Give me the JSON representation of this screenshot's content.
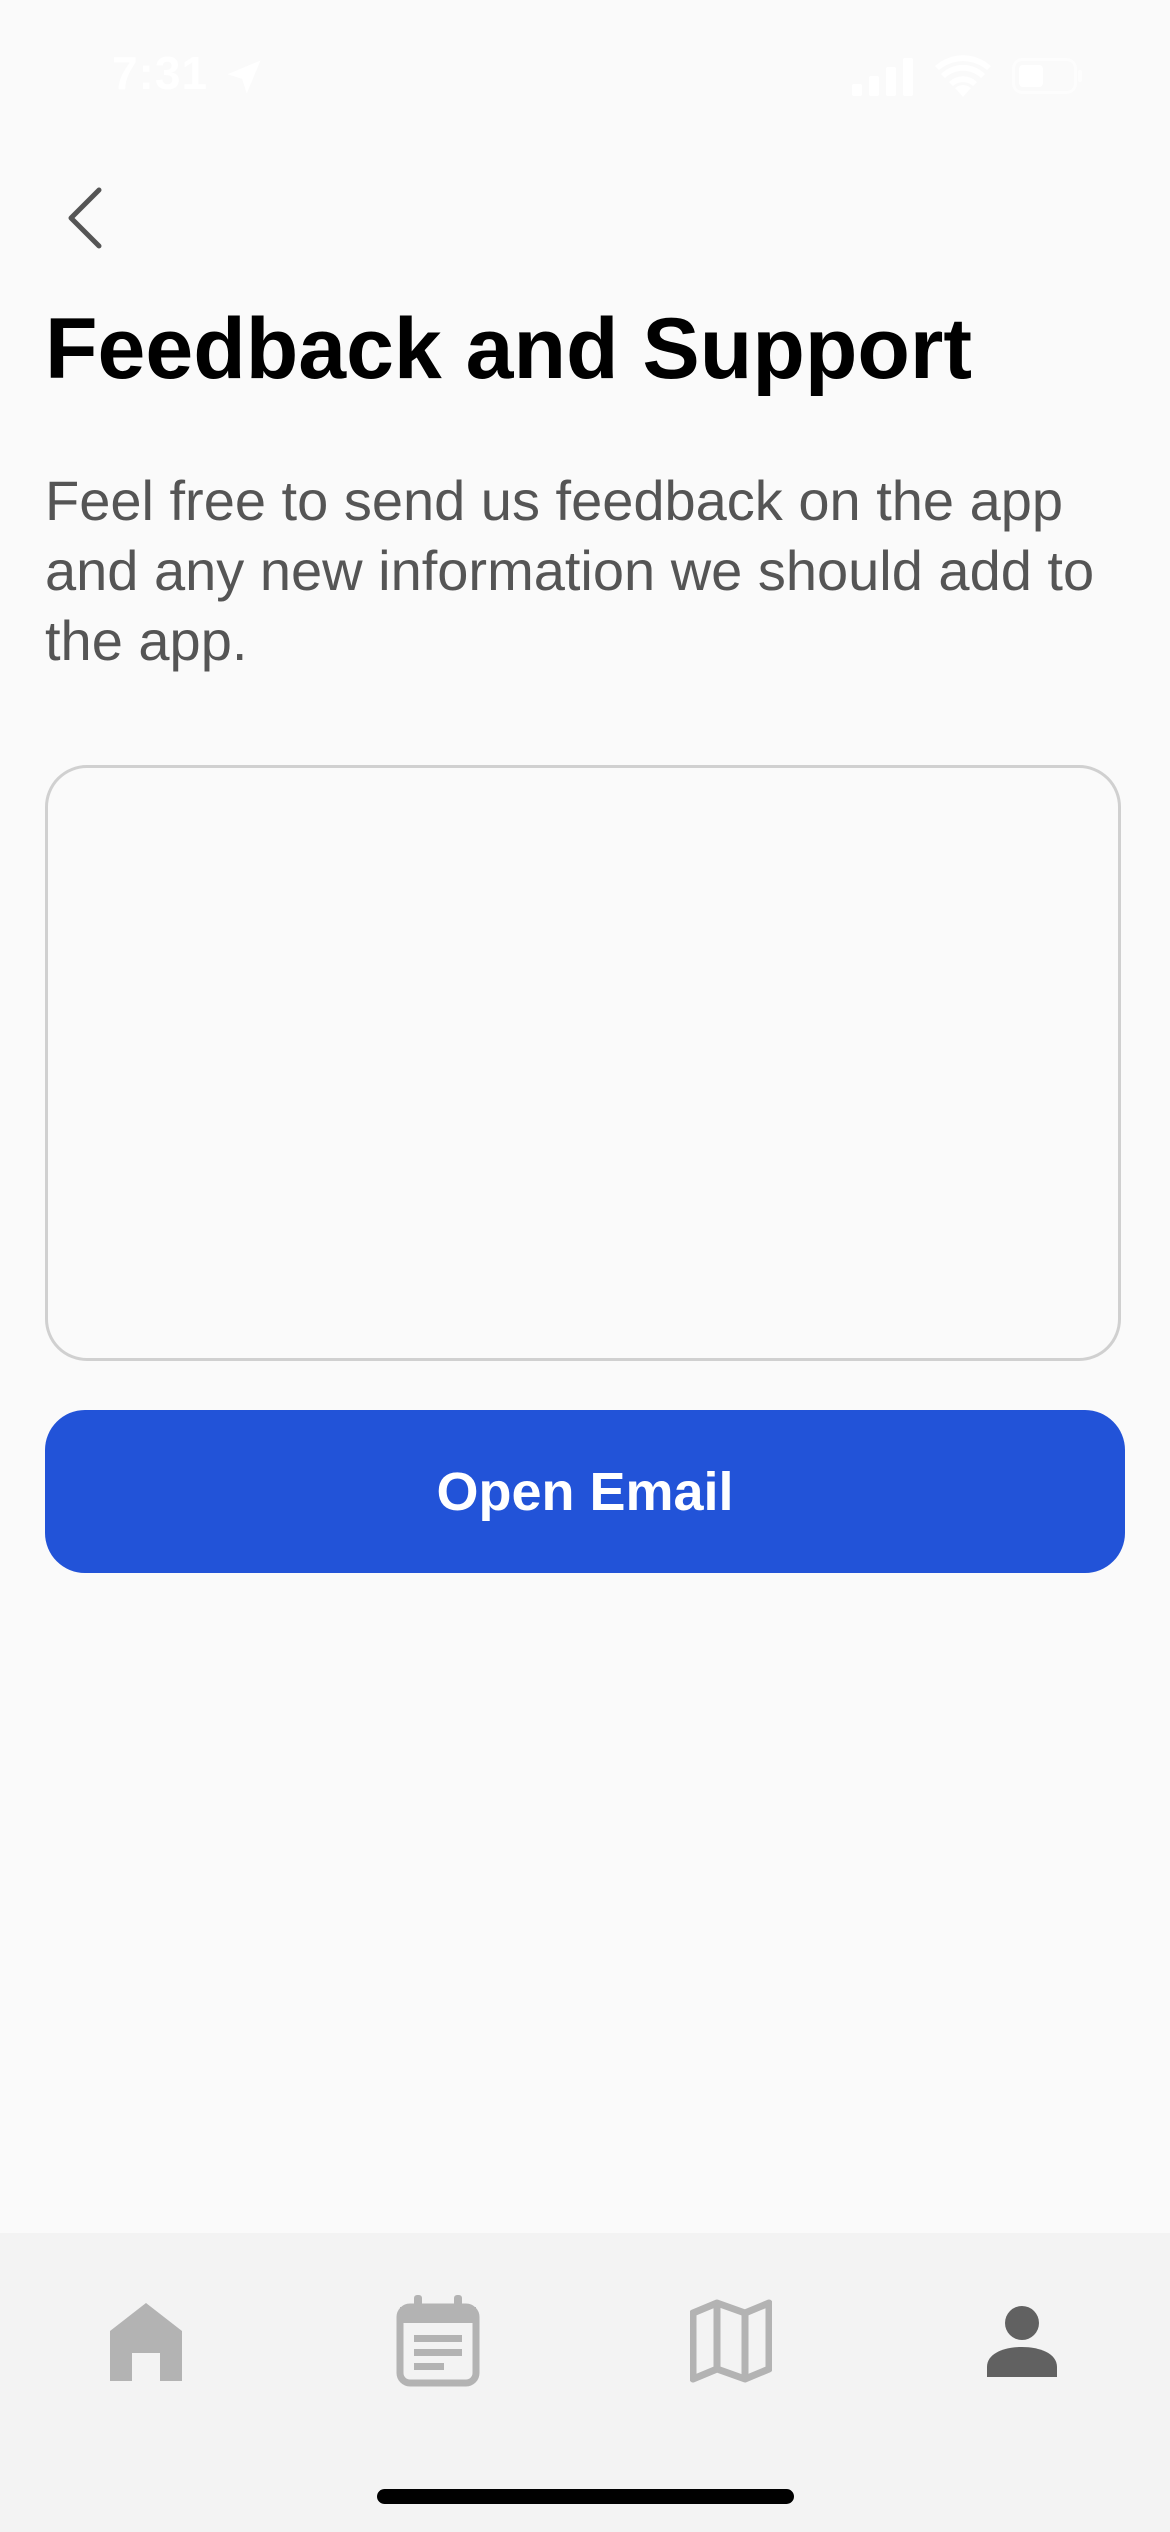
{
  "status_bar": {
    "time": "7:31",
    "location_icon": "location-arrow-icon",
    "signal_icon": "cellular-signal-icon",
    "wifi_icon": "wifi-icon",
    "battery_icon": "battery-icon"
  },
  "header": {
    "back_icon": "chevron-left-icon",
    "title": "Feedback and Support"
  },
  "main": {
    "description": "Feel free to send us feedback on the app and any new information we should add to the app.",
    "feedback_field": {
      "value": "",
      "placeholder": ""
    },
    "open_email_label": "Open Email"
  },
  "tab_bar": {
    "tabs": [
      {
        "icon": "home-icon",
        "active": false
      },
      {
        "icon": "calendar-icon",
        "active": false
      },
      {
        "icon": "map-icon",
        "active": false
      },
      {
        "icon": "profile-icon",
        "active": true
      }
    ]
  },
  "colors": {
    "accent": "#2253d8",
    "background": "#fafafa",
    "tab_bar": "#f3f3f3",
    "inactive_icon": "#b3b3b3",
    "active_icon": "#616161"
  }
}
